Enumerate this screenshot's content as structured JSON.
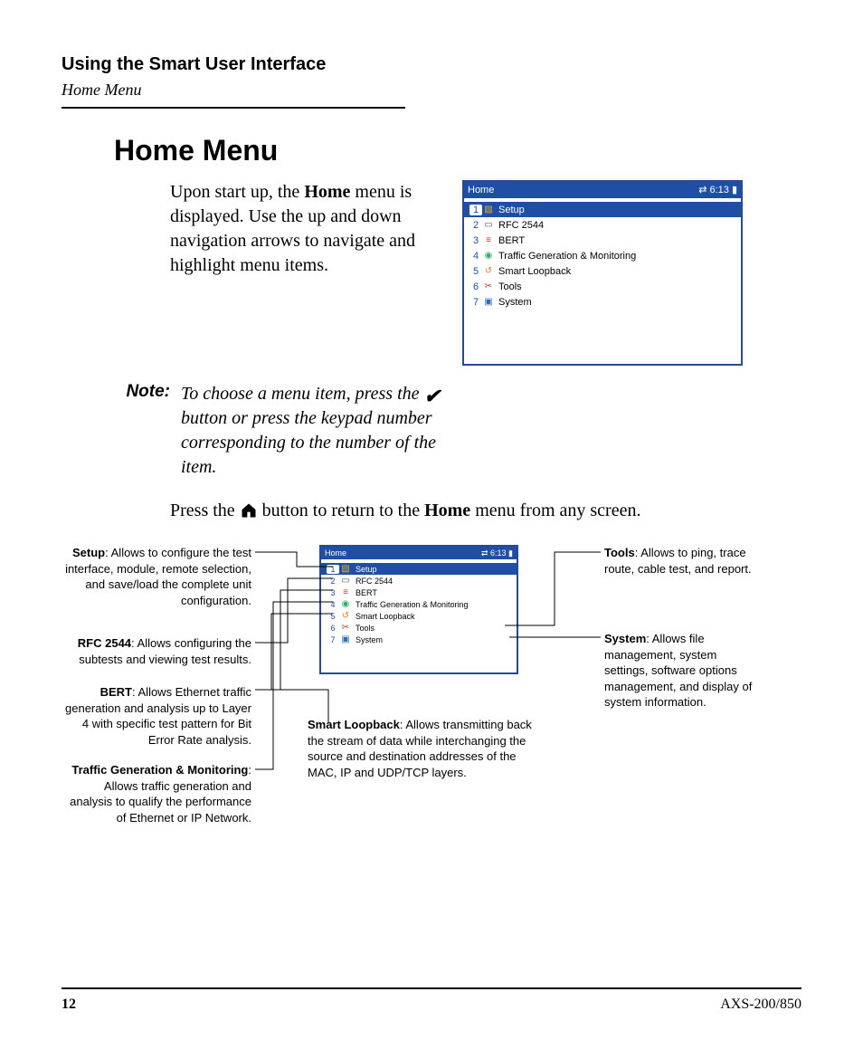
{
  "header": {
    "chapter": "Using the Smart User Interface",
    "section": "Home Menu"
  },
  "title": "Home Menu",
  "intro": {
    "p1a": "Upon start up, the ",
    "p1b_bold": "Home",
    "p1c": " menu is displayed. Use the up and down navigation arrows to navigate and highlight menu items."
  },
  "note": {
    "label": "Note:",
    "text_a": "To choose a menu item, press the ",
    "text_b": " button or press the keypad number corresponding to the number of the item."
  },
  "press_line": {
    "a": "Press the ",
    "b": " button to return to the ",
    "c_bold": "Home",
    "d": " menu from any screen."
  },
  "device": {
    "title": "Home",
    "time": "6:13",
    "items": [
      {
        "n": "1",
        "label": "Setup",
        "sel": true,
        "ic": "▧",
        "cls": "ic-setup"
      },
      {
        "n": "2",
        "label": "RFC 2544",
        "sel": false,
        "ic": "▭",
        "cls": "ic-rfc"
      },
      {
        "n": "3",
        "label": "BERT",
        "sel": false,
        "ic": "≡",
        "cls": "ic-bert"
      },
      {
        "n": "4",
        "label": "Traffic Generation  & Monitoring",
        "sel": false,
        "ic": "◉",
        "cls": "ic-traffic"
      },
      {
        "n": "5",
        "label": "Smart Loopback",
        "sel": false,
        "ic": "↺",
        "cls": "ic-loop"
      },
      {
        "n": "6",
        "label": "Tools",
        "sel": false,
        "ic": "✂",
        "cls": "ic-tools"
      },
      {
        "n": "7",
        "label": "System",
        "sel": false,
        "ic": "▣",
        "cls": "ic-sys"
      }
    ]
  },
  "callouts": {
    "setup": {
      "t": "Setup",
      "d": ": Allows to configure the test interface, module, remote selection, and save/load the complete unit configuration."
    },
    "rfc": {
      "t": "RFC 2544",
      "d": ": Allows configuring the subtests and viewing test results."
    },
    "bert": {
      "t": "BERT",
      "d": ": Allows Ethernet traffic generation and analysis up to Layer 4 with specific test pattern for Bit Error Rate analysis."
    },
    "tgm": {
      "t": "Traffic Generation & Monitoring",
      "d": ": Allows traffic generation and analysis to qualify the performance of Ethernet or IP Network."
    },
    "tools": {
      "t": "Tools",
      "d": ": Allows to ping, trace route, cable test, and report."
    },
    "system": {
      "t": "System",
      "d": ": Allows file management, system settings, software options management, and display of system information."
    },
    "loop": {
      "t": "Smart Loopback",
      "d": ": Allows transmitting back the stream of data while interchanging the source and destination addresses of the MAC, IP and UDP/TCP layers."
    }
  },
  "footer": {
    "page": "12",
    "model": "AXS-200/850"
  }
}
